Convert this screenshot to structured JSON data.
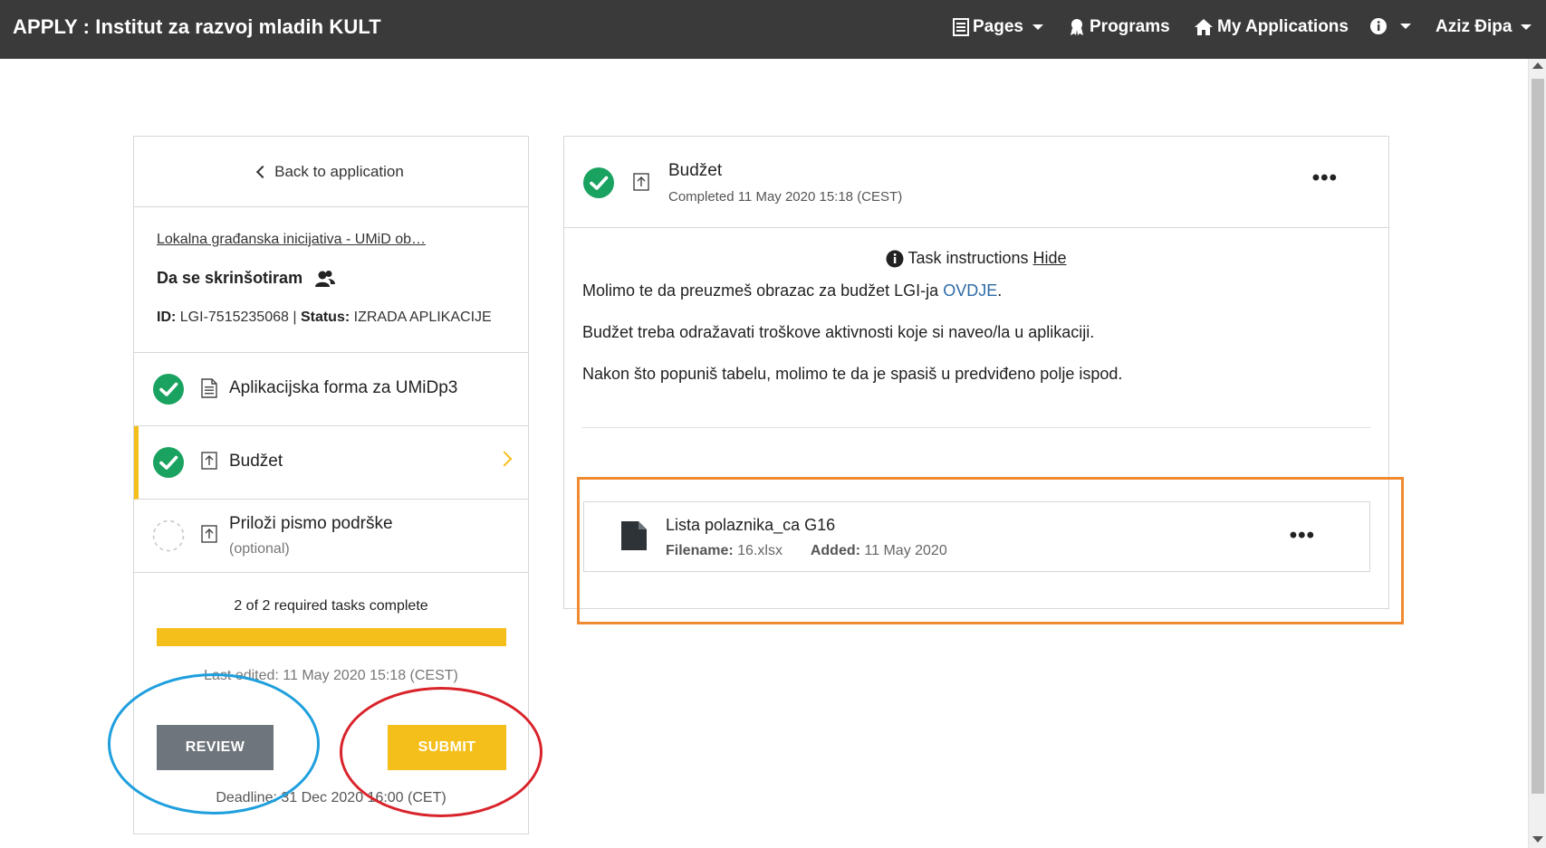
{
  "header": {
    "brand": "APPLY : Institut za razvoj mladih KULT",
    "nav": {
      "pages": "Pages",
      "programs": "Programs",
      "my_applications": "My Applications",
      "user": "Aziz Đipa"
    }
  },
  "sidebar": {
    "back_label": "Back to application",
    "program_link": "Lokalna građanska inicijativa - UMiD ob…",
    "app_title": "Da se skrinšotiram",
    "id_label": "ID:",
    "id_value": "LGI-7515235068",
    "separator": "|",
    "status_label": "Status:",
    "status_value": "IZRADA APLIKACIJE",
    "tasks": [
      {
        "label": "Aplikacijska forma za UMiDp3",
        "state": "complete",
        "icon": "document-icon"
      },
      {
        "label": "Budžet",
        "state": "complete",
        "icon": "upload-icon",
        "active": true
      },
      {
        "label": "Priloži pismo podrške",
        "sub": "(optional)",
        "state": "pending",
        "icon": "upload-icon"
      }
    ],
    "progress_text": "2 of 2 required tasks complete",
    "progress_fraction": 1.0,
    "last_edited": "Last edited: 11 May 2020 15:18 (CEST)",
    "review_label": "REVIEW",
    "submit_label": "SUBMIT",
    "deadline": "Deadline: 31 Dec 2020 16:00 (CET)"
  },
  "task_panel": {
    "title": "Budžet",
    "completed": "Completed 11 May 2020 15:18 (CEST)",
    "instructions_label": "Task instructions",
    "hide_label": "Hide",
    "para1_text": "Molimo te da preuzmeš obrazac za budžet LGI-ja ",
    "para1_link": "OVDJE",
    "para1_end": ".",
    "para2": "Budžet treba odražavati troškove aktivnosti koje si naveo/la u aplikaciji.",
    "para3": "Nakon što popuniš tabelu, molimo te da je spasiš u predviđeno polje ispod.",
    "file": {
      "name": "Lista polaznika_ca G16",
      "filename_label": "Filename:",
      "filename": "16.xlsx",
      "added_label": "Added:",
      "added": "11 May 2020"
    }
  },
  "colors": {
    "topbar": "#3a3a3a",
    "accent": "#f5bf1b",
    "success": "#1aa260",
    "review_button": "#6e757c",
    "annotation_blue": "#1f9fdd",
    "annotation_red": "#d9232b",
    "annotation_orange": "#f08a31"
  }
}
